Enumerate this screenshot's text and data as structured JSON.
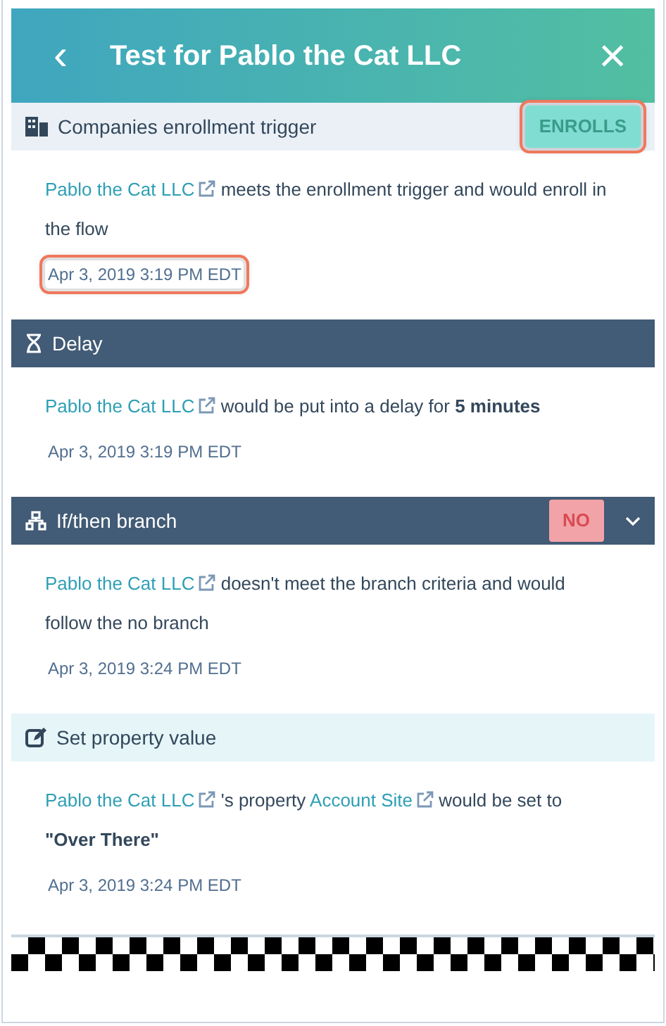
{
  "header": {
    "title": "Test for Pablo the Cat LLC",
    "back": "‹",
    "close": "×"
  },
  "steps": [
    {
      "kind": "trigger",
      "title": "Companies enrollment trigger",
      "badge": {
        "text": "ENROLLS",
        "kind": "success",
        "highlighted": true
      },
      "expandable": false,
      "sentence": [
        {
          "kind": "link",
          "text": "Pablo the Cat LLC"
        },
        {
          "kind": "text",
          "text": " meets the enrollment trigger and would enroll in the flow"
        }
      ],
      "timestamp": {
        "text": "Apr 3, 2019 3:19 PM EDT",
        "highlighted": true
      }
    },
    {
      "kind": "delay",
      "title": "Delay",
      "expandable": false,
      "sentence": [
        {
          "kind": "link",
          "text": "Pablo the Cat LLC"
        },
        {
          "kind": "text",
          "text": " would be put into a delay for "
        },
        {
          "kind": "bold",
          "text": "5 minutes"
        }
      ],
      "timestamp": {
        "text": "Apr 3, 2019 3:19 PM EDT",
        "highlighted": false
      }
    },
    {
      "kind": "branch",
      "title": "If/then branch",
      "badge": {
        "text": "NO",
        "kind": "danger",
        "highlighted": false
      },
      "expandable": true,
      "sentence": [
        {
          "kind": "link",
          "text": "Pablo the Cat LLC"
        },
        {
          "kind": "text",
          "text": " doesn't meet the branch criteria and would follow the no branch"
        }
      ],
      "timestamp": {
        "text": "Apr 3, 2019 3:24 PM EDT",
        "highlighted": false
      }
    },
    {
      "kind": "action",
      "title": "Set property value",
      "expandable": false,
      "sentence": [
        {
          "kind": "link",
          "text": "Pablo the Cat LLC"
        },
        {
          "kind": "text",
          "text": " 's property "
        },
        {
          "kind": "link",
          "text": "Account Site"
        },
        {
          "kind": "text",
          "text": " would be set to "
        },
        {
          "kind": "bold",
          "text": "\"Over There\""
        }
      ],
      "timestamp": {
        "text": "Apr 3, 2019 3:24 PM EDT",
        "highlighted": false
      }
    }
  ]
}
